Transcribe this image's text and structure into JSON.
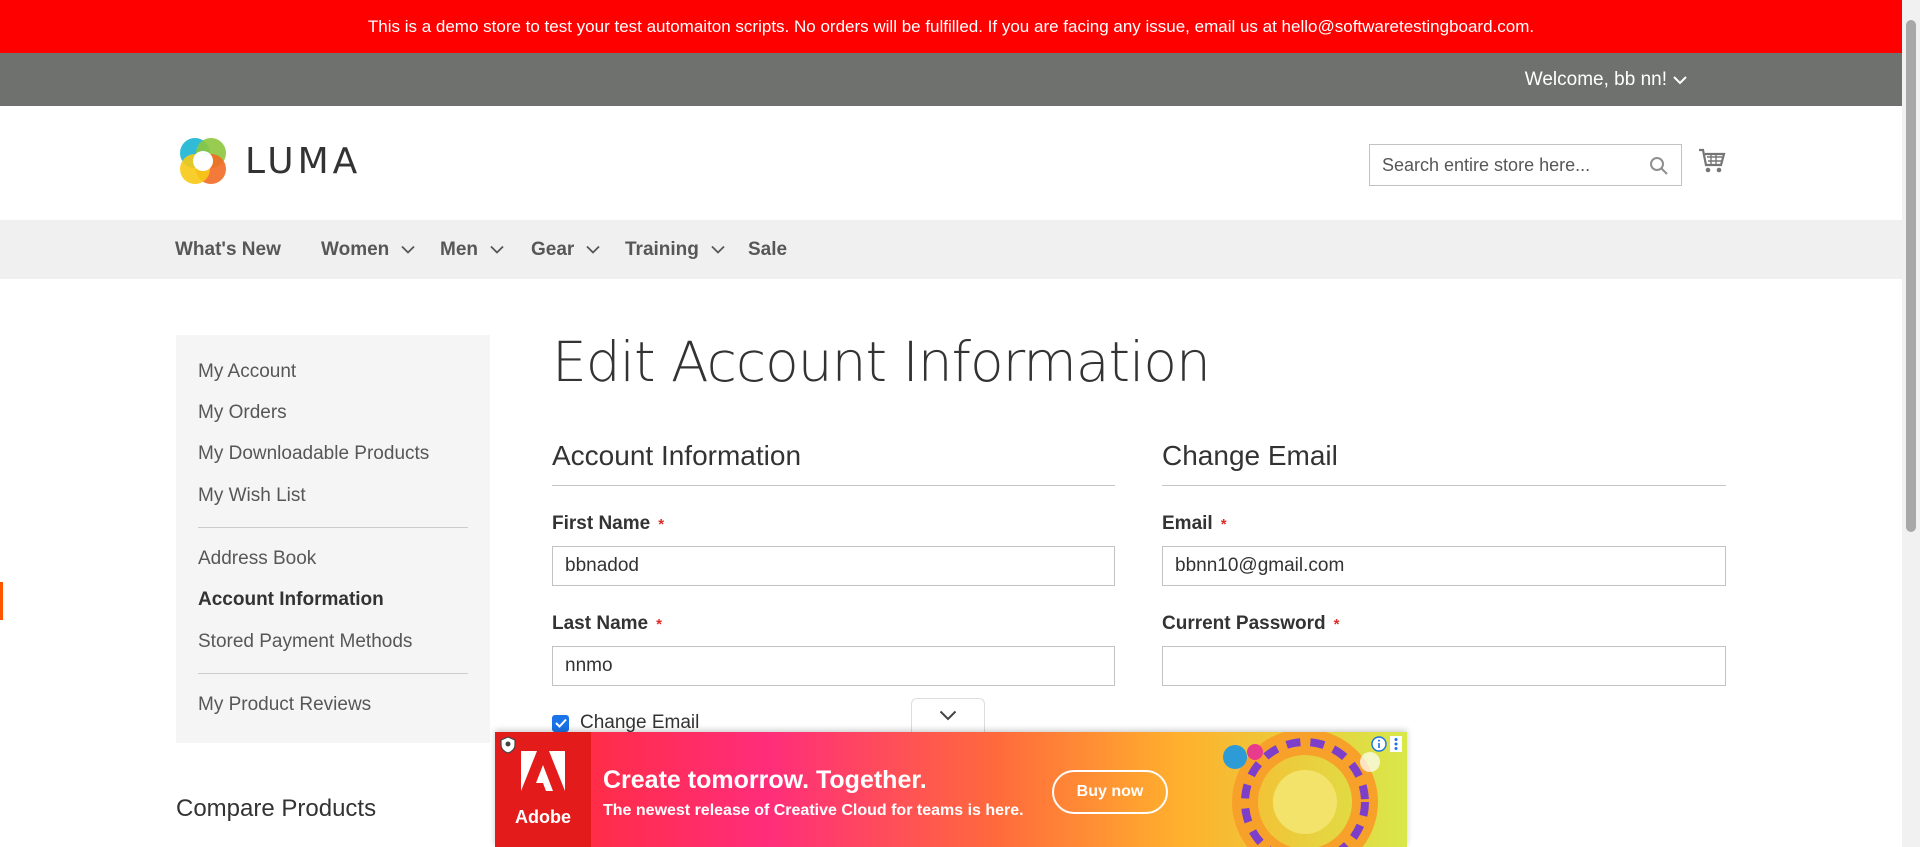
{
  "demo_notice": "This is a demo store to test your test automaiton scripts. No orders will be fulfilled. If you are facing any issue, email us at hello@softwaretestingboard.com.",
  "header": {
    "welcome": "Welcome, bb nn!",
    "logo_text": "LUMA",
    "search_placeholder": "Search entire store here..."
  },
  "nav": {
    "items": [
      {
        "label": "What's New"
      },
      {
        "label": "Women"
      },
      {
        "label": "Men"
      },
      {
        "label": "Gear"
      },
      {
        "label": "Training"
      },
      {
        "label": "Sale"
      }
    ]
  },
  "sidebar": {
    "items": [
      {
        "label": "My Account"
      },
      {
        "label": "My Orders"
      },
      {
        "label": "My Downloadable Products"
      },
      {
        "label": "My Wish List"
      },
      {
        "label": "Address Book"
      },
      {
        "label": "Account Information"
      },
      {
        "label": "Stored Payment Methods"
      },
      {
        "label": "My Product Reviews"
      }
    ],
    "active": "Account Information",
    "compare_title": "Compare Products"
  },
  "main": {
    "page_title": "Edit Account Information",
    "account_info": {
      "title": "Account Information",
      "first_name_label": "First Name",
      "first_name_value": "bbnadod",
      "last_name_label": "Last Name",
      "last_name_value": "nnmo",
      "change_email_label": "Change Email",
      "required_mark": "*"
    },
    "change_email": {
      "title": "Change Email",
      "email_label": "Email",
      "email_value": "bbnn10@gmail.com",
      "password_label": "Current Password",
      "password_value": ""
    }
  },
  "ad": {
    "brand": "Adobe",
    "headline": "Create tomorrow. Together.",
    "subline": "The newest release of Creative Cloud for teams is here.",
    "button": "Buy now"
  },
  "colors": {
    "demo_bar": "#ff0000",
    "panel_bar": "#6e716e",
    "accent": "#ff5501",
    "required": "#e02b27"
  }
}
